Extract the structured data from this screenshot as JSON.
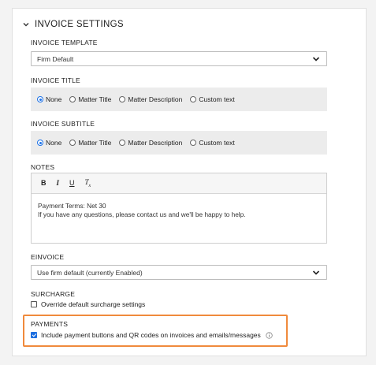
{
  "section": {
    "title": "INVOICE SETTINGS"
  },
  "invoice_template": {
    "label": "INVOICE TEMPLATE",
    "value": "Firm Default"
  },
  "invoice_title": {
    "label": "INVOICE TITLE",
    "options": [
      "None",
      "Matter Title",
      "Matter Description",
      "Custom text"
    ],
    "selected": "None"
  },
  "invoice_subtitle": {
    "label": "INVOICE SUBTITLE",
    "options": [
      "None",
      "Matter Title",
      "Matter Description",
      "Custom text"
    ],
    "selected": "None"
  },
  "notes": {
    "label": "NOTES",
    "toolbar": {
      "bold": "B",
      "italic": "I",
      "underline": "U",
      "clear": "T",
      "clear_sub": "x"
    },
    "line1": "Payment Terms: Net 30",
    "line2": "If you have any questions, please contact us and we'll be happy to help."
  },
  "einvoice": {
    "label": "EINVOICE",
    "value": "Use firm default (currently Enabled)"
  },
  "surcharge": {
    "label": "SURCHARGE",
    "checkbox_label": "Override default surcharge settings",
    "checked": false
  },
  "payments": {
    "label": "PAYMENTS",
    "checkbox_label": "Include payment buttons and QR codes on invoices and emails/messages",
    "checked": true
  },
  "colors": {
    "accent": "#1e73e8",
    "highlight": "#f08a3c",
    "panel": "#ececec"
  },
  "icons": [
    "chevron-down-icon",
    "info-icon"
  ]
}
